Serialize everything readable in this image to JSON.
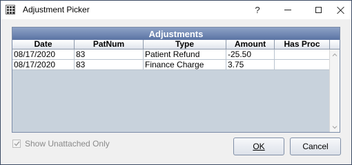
{
  "window": {
    "title": "Adjustment Picker",
    "help_label": "?"
  },
  "grid": {
    "title": "Adjustments",
    "columns": [
      "Date",
      "PatNum",
      "Type",
      "Amount",
      "Has Proc"
    ],
    "rows": [
      [
        "08/17/2020",
        "83",
        "Patient Refund",
        "-25.50",
        ""
      ],
      [
        "08/17/2020",
        "83",
        "Finance Charge",
        "3.75",
        ""
      ]
    ]
  },
  "options": {
    "show_unattached_label": "Show Unattached Only",
    "show_unattached_checked": true,
    "show_unattached_enabled": false
  },
  "buttons": {
    "ok_label": "OK",
    "cancel_label": "Cancel"
  },
  "icons": {
    "app": "grid-app-icon",
    "help": "help-icon",
    "minimize": "minimize-icon",
    "maximize": "maximize-icon",
    "close": "close-icon",
    "scroll_up": "chevron-up-icon",
    "scroll_down": "chevron-down-icon",
    "check": "checkmark-icon"
  },
  "colors": {
    "grid_title_bg": "#5a73a3",
    "grid_body_bg": "#c8d2dc",
    "window_bg": "#f0f0f0"
  }
}
